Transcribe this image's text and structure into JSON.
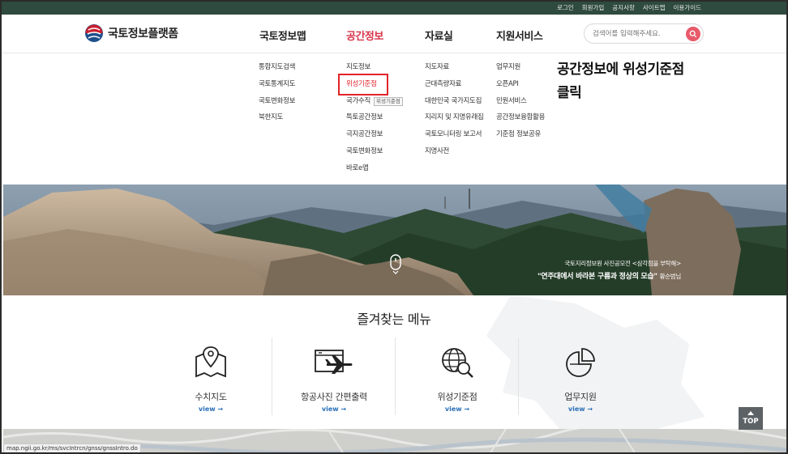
{
  "util_links": [
    "로그인",
    "회원가입",
    "공지사항",
    "사이트맵",
    "이용가이드"
  ],
  "logo": {
    "text": "국토정보플랫폼"
  },
  "gnb": [
    {
      "label": "국토정보맵",
      "active": false
    },
    {
      "label": "공간정보",
      "active": true
    },
    {
      "label": "자료실",
      "active": false
    },
    {
      "label": "지원서비스",
      "active": false
    }
  ],
  "search": {
    "placeholder": "검색어를 입력해주세요."
  },
  "mega": {
    "col1": [
      "통합지도검색",
      "국토통계지도",
      "국토변화정보",
      "북한지도"
    ],
    "col2": [
      "지도정보",
      "위성기준점",
      "국가수직",
      "특토공간정보",
      "극지공간정보",
      "국토변화정보",
      "바로e맵"
    ],
    "col3": [
      "지도자료",
      "근대측량자료",
      "대한민국 국가지도집",
      "지리지 및 지명유래집",
      "국토모니터링 보고서",
      "지명사전"
    ],
    "col4": [
      "업무지원",
      "오픈API",
      "민원서비스",
      "공간정보융합활용",
      "기준점 정보공유"
    ]
  },
  "tooltip": "위성기준점",
  "instruction": {
    "line1": "공간정보에 위성기준점",
    "line2": "클릭"
  },
  "hero": {
    "caption_line1": "국토지리정보원 사진공모전 <삼각점을 부탁해>",
    "caption_quote": "\"연주대에서 바라본 구름과 정상의 모습\"",
    "caption_author": "황순범님"
  },
  "favorites": {
    "title": "즐겨찾는 메뉴",
    "items": [
      {
        "label": "수치지도",
        "view": "view →",
        "icon": "map-pin-icon"
      },
      {
        "label": "항공사진 간편출력",
        "view": "view →",
        "icon": "airplane-icon"
      },
      {
        "label": "위성기준점",
        "view": "view →",
        "icon": "globe-search-icon"
      },
      {
        "label": "업무지원",
        "view": "view →",
        "icon": "pie-chart-icon"
      }
    ]
  },
  "top_button": "TOP",
  "status_url": "map.ngii.go.kr/ms/svcIntrcn/gnss/gnssIntro.do",
  "colors": {
    "utilbar": "#2f4a3e",
    "active": "#d8344a",
    "highlight": "#e2232a",
    "view_link": "#2a6fb8"
  }
}
